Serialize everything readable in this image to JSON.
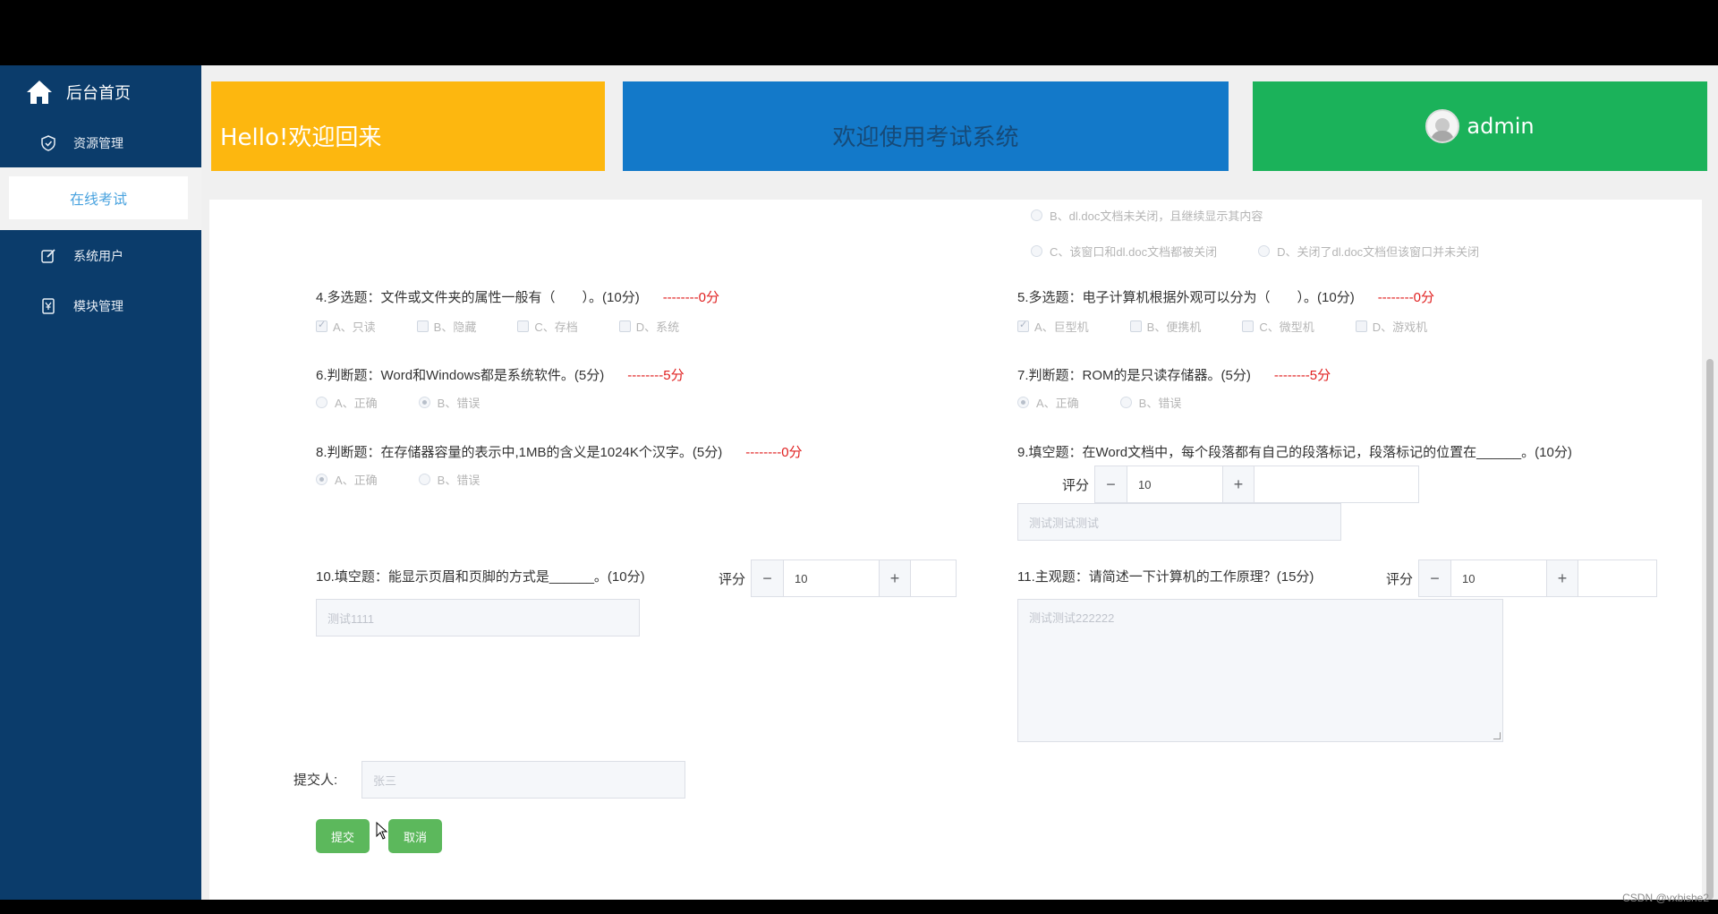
{
  "sidebar": {
    "home_label": "后台首页",
    "items": [
      {
        "label": "资源管理",
        "icon": "shield-icon"
      },
      {
        "label": "在线考试",
        "icon": ""
      },
      {
        "label": "系统用户",
        "icon": "edit-icon"
      },
      {
        "label": "模块管理",
        "icon": "bookmark-icon"
      }
    ]
  },
  "header": {
    "welcome": "Hello!欢迎回来",
    "system_title": "欢迎使用考试系统",
    "user_name": "admin"
  },
  "exam": {
    "prev_options": {
      "b": "B、dl.doc文档未关闭，且继续显示其内容",
      "c": "C、该窗口和dl.doc文档都被关闭",
      "d": "D、关闭了dl.doc文档但该窗口并未关闭"
    },
    "q4": {
      "text": "4.多选题：文件或文件夹的属性一般有（　　）。(10分)",
      "score": "--------0分",
      "options": [
        "A、只读",
        "B、隐藏",
        "C、存档",
        "D、系统"
      ]
    },
    "q5": {
      "text": "5.多选题：电子计算机根据外观可以分为（　　）。(10分)",
      "score": "--------0分",
      "options": [
        "A、巨型机",
        "B、便携机",
        "C、微型机",
        "D、游戏机"
      ]
    },
    "q6": {
      "text": "6.判断题：Word和Windows都是系统软件。(5分)",
      "score": "--------5分",
      "options": [
        "A、正确",
        "B、错误"
      ]
    },
    "q7": {
      "text": "7.判断题：ROM的是只读存储器。(5分)",
      "score": "--------5分",
      "options": [
        "A、正确",
        "B、错误"
      ]
    },
    "q8": {
      "text": "8.判断题：在存储器容量的表示中,1MB的含义是1024K个汉字。(5分)",
      "score": "--------0分",
      "options": [
        "A、正确",
        "B、错误"
      ]
    },
    "q9": {
      "text": "9.填空题：在Word文档中，每个段落都有自己的段落标记，段落标记的位置在______。(10分)",
      "grade_label": "评分",
      "grade_value": "10",
      "answer": "测试测试测试"
    },
    "q10": {
      "text": "10.填空题：能显示页眉和页脚的方式是______。(10分)",
      "grade_label": "评分",
      "grade_value": "10",
      "answer": "测试1111"
    },
    "q11": {
      "text": "11.主观题：请简述一下计算机的工作原理？(15分)",
      "grade_label": "评分",
      "grade_value": "10",
      "answer": "测试测试222222"
    },
    "submitter_label": "提交人:",
    "submitter_placeholder": "张三",
    "submit_label": "提交",
    "cancel_label": "取消",
    "stepper_minus": "−",
    "stepper_plus": "+"
  },
  "watermark": "CSDN @vxbishe2",
  "colors": {
    "sidebar": "#0b3c6b",
    "yellow": "#fdb70f",
    "blue": "#1379c9",
    "green": "#1bb25a",
    "score_red": "#e02020",
    "button_green": "#5cb85c"
  }
}
